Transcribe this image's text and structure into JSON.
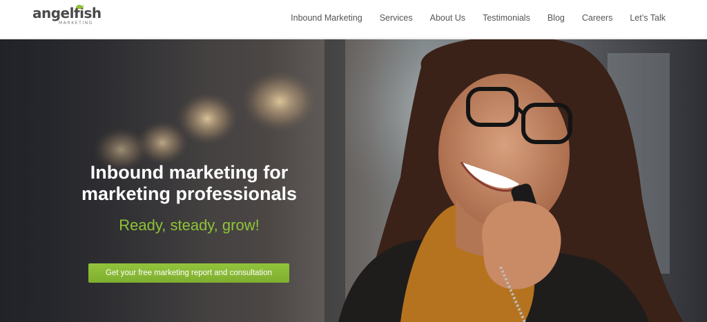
{
  "brand": {
    "name": "angelfish",
    "sub": "MARKETING",
    "accent_color": "#8fc436"
  },
  "nav": {
    "items": [
      {
        "label": "Inbound Marketing"
      },
      {
        "label": "Services"
      },
      {
        "label": "About Us"
      },
      {
        "label": "Testimonials"
      },
      {
        "label": "Blog"
      },
      {
        "label": "Careers"
      },
      {
        "label": "Let’s Talk"
      }
    ]
  },
  "hero": {
    "title_line1": "Inbound marketing for",
    "title_line2": "marketing professionals",
    "tagline": "Ready, steady, grow!",
    "cta_label": "Get your free marketing report and consultation",
    "cta_color": "#8cbd38"
  }
}
